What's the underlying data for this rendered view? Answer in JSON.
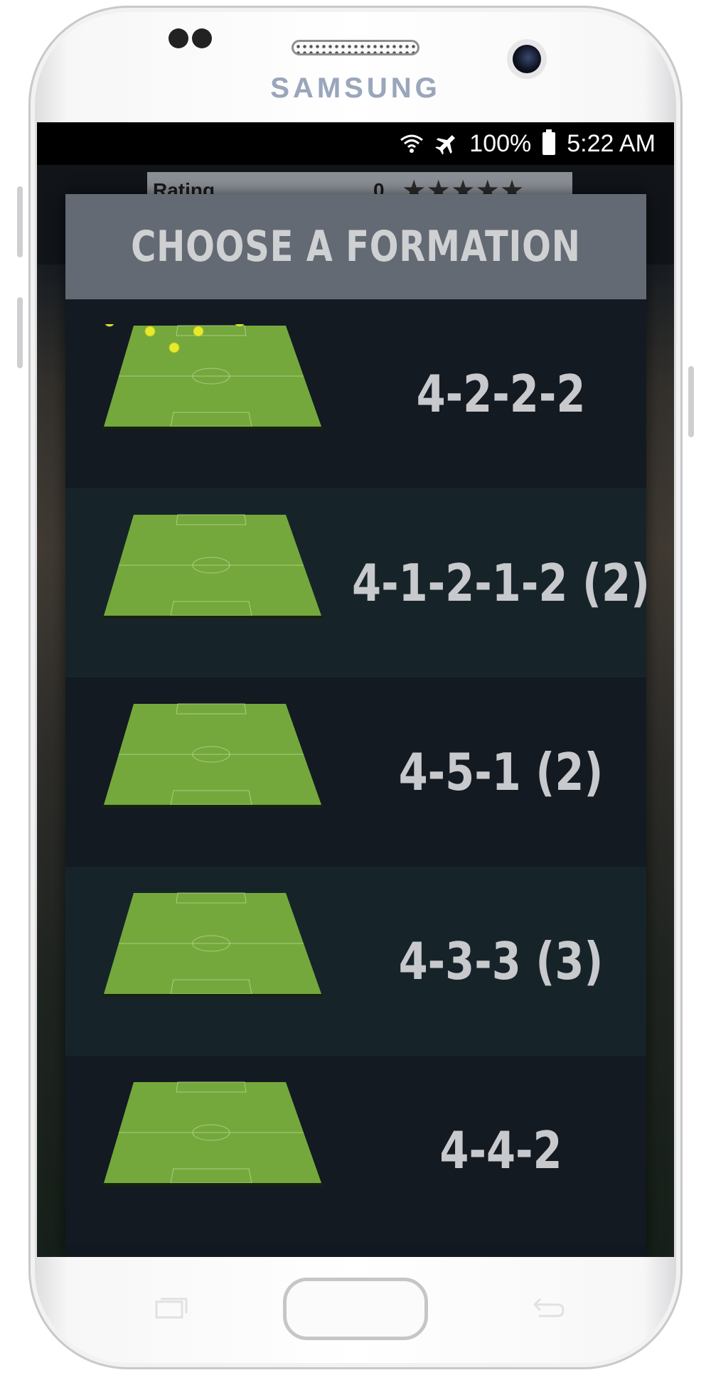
{
  "device": {
    "brand": "SAMSUNG"
  },
  "status_bar": {
    "icons": [
      "wifi-icon",
      "airplane-mode-icon",
      "battery-icon"
    ],
    "battery_percent": "100%",
    "time": "5:22 AM"
  },
  "background_screen": {
    "rating_label": "Rating",
    "rating_value": "0",
    "stars": "★★★★★"
  },
  "dialog": {
    "title": "CHOOSE A FORMATION",
    "formations": [
      {
        "name": "4-2-2-2"
      },
      {
        "name": "4-1-2-1-2 (2)"
      },
      {
        "name": "4-5-1 (2)"
      },
      {
        "name": "4-3-3 (3)"
      },
      {
        "name": "4-4-2"
      }
    ]
  },
  "colors": {
    "dialog_header": "#636a74",
    "row_dark": "#131a22",
    "row_teal": "#16242a",
    "pitch_green": "#74a83c",
    "player_dot": "#e6ea2c"
  }
}
